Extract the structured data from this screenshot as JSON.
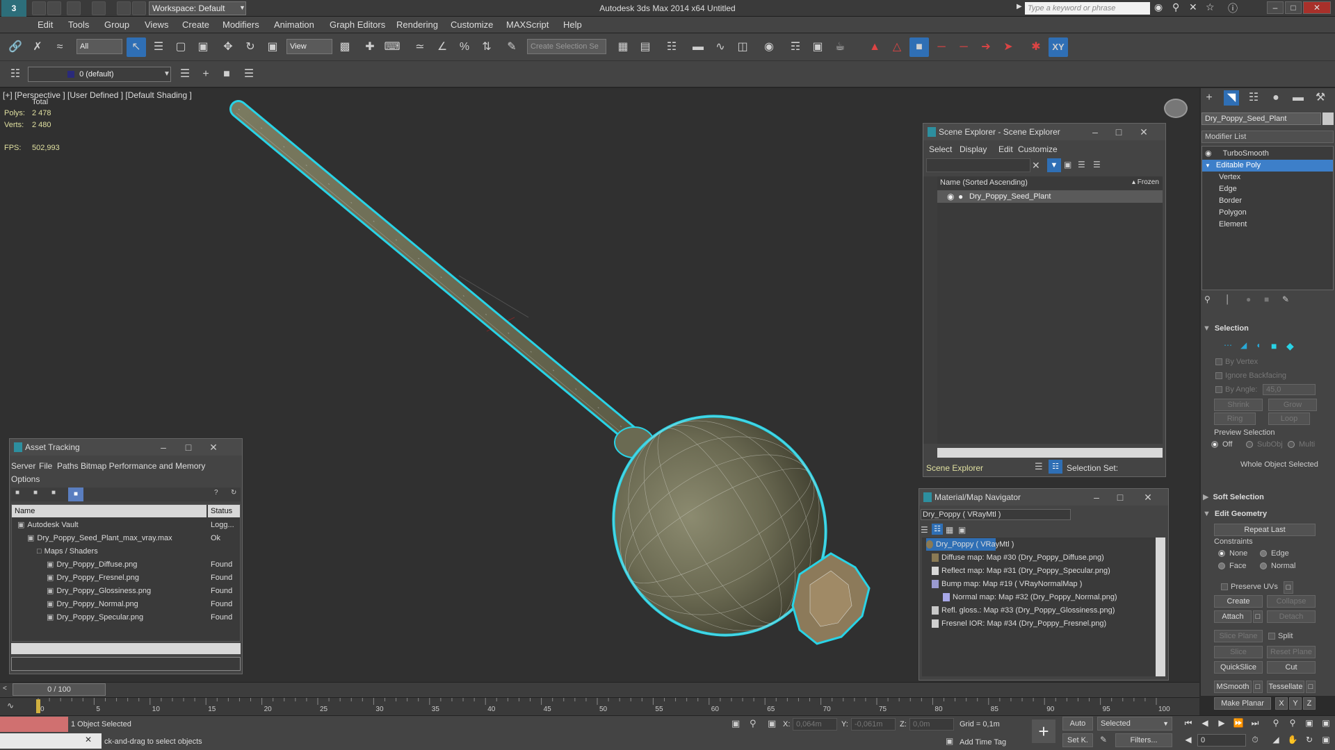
{
  "window": {
    "app_title": "Autodesk 3ds Max  2014 x64     Untitled",
    "workspace": "Workspace: Default",
    "search_placeholder": "Type a keyword or phrase"
  },
  "menu": [
    "Edit",
    "Tools",
    "Group",
    "Views",
    "Create",
    "Modifiers",
    "Animation",
    "Graph Editors",
    "Rendering",
    "Customize",
    "MAXScript",
    "Help"
  ],
  "toolbar": {
    "selection_filter": "All",
    "ref_coord": "View",
    "named_selection": "Create Selection Se",
    "layer": "0 (default)",
    "xy_label": "XY"
  },
  "viewport": {
    "label": "[+] [Perspective ] [User Defined ] [Default Shading ]",
    "stats_header": "Total",
    "polys_label": "Polys:",
    "polys_value": "2 478",
    "verts_label": "Verts:",
    "verts_value": "2 480",
    "fps_label": "FPS:",
    "fps_value": "502,993"
  },
  "command_panel": {
    "object_name": "Dry_Poppy_Seed_Plant",
    "modifier_list": "Modifier List",
    "stack": [
      {
        "label": "TurboSmooth",
        "kind": "modifier"
      },
      {
        "label": "Editable Poly",
        "kind": "base",
        "selected": true
      },
      {
        "label": "Vertex",
        "kind": "sub"
      },
      {
        "label": "Edge",
        "kind": "sub"
      },
      {
        "label": "Border",
        "kind": "sub"
      },
      {
        "label": "Polygon",
        "kind": "sub"
      },
      {
        "label": "Element",
        "kind": "sub"
      }
    ],
    "selection": {
      "title": "Selection",
      "by_vertex": "By Vertex",
      "ignore_backfacing": "Ignore Backfacing",
      "by_angle": "By Angle:",
      "by_angle_value": "45,0",
      "shrink": "Shrink",
      "grow": "Grow",
      "ring": "Ring",
      "loop": "Loop",
      "preview_selection": "Preview Selection",
      "off": "Off",
      "subobj": "SubObj",
      "multi": "Multi",
      "status": "Whole Object Selected"
    },
    "soft_selection": "Soft Selection",
    "edit_geometry": {
      "title": "Edit Geometry",
      "repeat_last": "Repeat Last",
      "constraints": "Constraints",
      "none": "None",
      "edge": "Edge",
      "face": "Face",
      "normal": "Normal",
      "preserve_uvs": "Preserve UVs",
      "create": "Create",
      "collapse": "Collapse",
      "attach": "Attach",
      "detach": "Detach",
      "slice_plane": "Slice Plane",
      "split": "Split",
      "slice": "Slice",
      "reset_plane": "Reset Plane",
      "quickslice": "QuickSlice",
      "cut": "Cut",
      "msmooth": "MSmooth",
      "tessellate": "Tessellate",
      "make_planar": "Make Planar",
      "x": "X",
      "y": "Y",
      "z": "Z"
    }
  },
  "scene_explorer": {
    "title": "Scene Explorer - Scene Explorer",
    "menu": [
      "Select",
      "Display",
      "Edit",
      "Customize"
    ],
    "col_name": "Name (Sorted Ascending)",
    "col_frozen": "▴ Frozen",
    "item": "Dry_Poppy_Seed_Plant",
    "footer_label": "Scene Explorer",
    "selection_set": "Selection Set:"
  },
  "asset_tracking": {
    "title": "Asset Tracking",
    "menu": [
      "Server",
      "File",
      "Paths",
      "Bitmap Performance and Memory",
      "Options"
    ],
    "col_name": "Name",
    "col_status": "Status",
    "rows": [
      {
        "name": "Autodesk Vault",
        "status": "Logg...",
        "indent": 0
      },
      {
        "name": "Dry_Poppy_Seed_Plant_max_vray.max",
        "status": "Ok",
        "indent": 1
      },
      {
        "name": "Maps / Shaders",
        "status": "",
        "indent": 2
      },
      {
        "name": "Dry_Poppy_Diffuse.png",
        "status": "Found",
        "indent": 3
      },
      {
        "name": "Dry_Poppy_Fresnel.png",
        "status": "Found",
        "indent": 3
      },
      {
        "name": "Dry_Poppy_Glossiness.png",
        "status": "Found",
        "indent": 3
      },
      {
        "name": "Dry_Poppy_Normal.png",
        "status": "Found",
        "indent": 3
      },
      {
        "name": "Dry_Poppy_Specular.png",
        "status": "Found",
        "indent": 3
      }
    ]
  },
  "material_navigator": {
    "title": "Material/Map Navigator",
    "material_field": "Dry_Poppy  ( VRayMtl )",
    "root": "Dry_Poppy  ( VRayMtl )",
    "maps": [
      {
        "label": "Diffuse map: Map #30 (Dry_Poppy_Diffuse.png)",
        "color": "#8a7a55"
      },
      {
        "label": "Reflect map: Map #31 (Dry_Poppy_Specular.png)",
        "color": "#d8d8d8"
      },
      {
        "label": "Bump map: Map #19  ( VRayNormalMap )",
        "color": "#9a9ad0"
      },
      {
        "label": "Normal map: Map #32 (Dry_Poppy_Normal.png)",
        "color": "#a8a8e8"
      },
      {
        "label": "Refl. gloss.: Map #33 (Dry_Poppy_Glossiness.png)",
        "color": "#c8c8c8"
      },
      {
        "label": "Fresnel IOR: Map #34 (Dry_Poppy_Fresnel.png)",
        "color": "#d0d0d0"
      }
    ]
  },
  "timeline": {
    "frame": "0 / 100",
    "ticks": [
      "0",
      "5",
      "10",
      "15",
      "20",
      "25",
      "30",
      "35",
      "40",
      "45",
      "50",
      "55",
      "60",
      "65",
      "70",
      "75",
      "80",
      "85",
      "90",
      "95",
      "100"
    ]
  },
  "status": {
    "selected": "1 Object Selected",
    "prompt": "ck-and-drag to select objects",
    "x_label": "X:",
    "x_value": "0,064m",
    "y_label": "Y:",
    "y_value": "-0,061m",
    "z_label": "Z:",
    "z_value": "0,0m",
    "grid": "Grid = 0,1m",
    "auto": "Auto",
    "set_key": "Set K.",
    "key_mode": "Selected",
    "filters": "Filters...",
    "add_time_tag": "Add Time Tag",
    "frame_field": "0"
  },
  "colors": {
    "selection_cyan": "#29d3e6",
    "stack_selected": "#3d7fc9",
    "highlight_blue": "#2f6fb5"
  }
}
